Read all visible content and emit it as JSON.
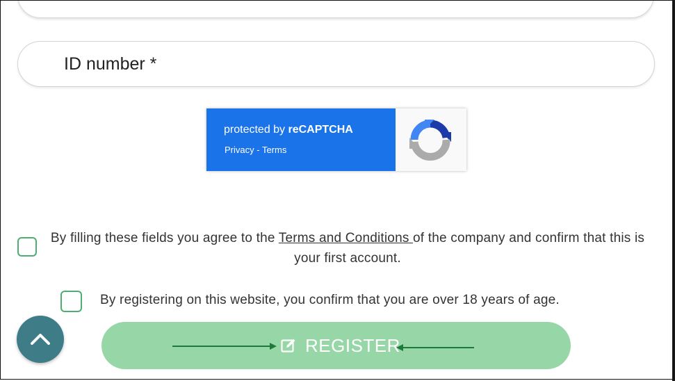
{
  "form": {
    "top_field_partial": "",
    "id_field": {
      "placeholder": "ID number *",
      "value": ""
    },
    "recaptcha": {
      "prefix": "protected by ",
      "brand": "reCAPTCHA",
      "privacy_label": "Privacy",
      "separator": " - ",
      "terms_label": "Terms"
    },
    "terms_agreement": {
      "text_before": "By filling these fields you agree to the ",
      "link_label": "Terms and Conditions ",
      "text_after": "of the company and confirm that this is your first account.",
      "checked": false
    },
    "age_confirmation": {
      "text": "By registering on this website, you confirm that you are over 18 years of age.",
      "checked": false
    },
    "register_button": {
      "label": "REGISTER",
      "icon": "edit-icon",
      "color": "#97d6a7"
    }
  },
  "scroll_top": {
    "icon": "chevron-up-icon",
    "color": "#3e7c88"
  },
  "annotations": {
    "arrow_color": "#1e7a3a"
  }
}
